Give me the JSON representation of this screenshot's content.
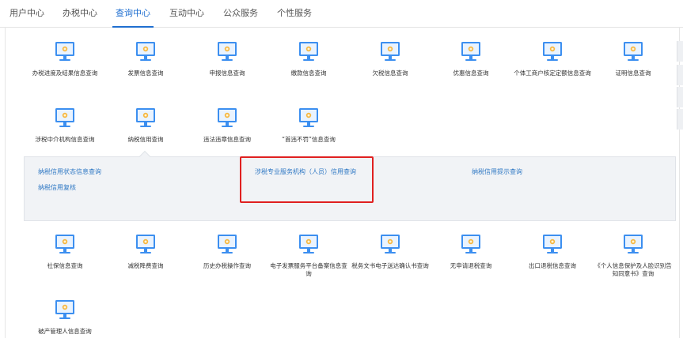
{
  "nav": {
    "tabs": [
      {
        "label": "用户中心"
      },
      {
        "label": "办税中心"
      },
      {
        "label": "查询中心"
      },
      {
        "label": "互动中心"
      },
      {
        "label": "公众服务"
      },
      {
        "label": "个性服务"
      }
    ]
  },
  "icon_name": "monitor-icon",
  "colors": {
    "accent": "#1f6fd0",
    "icon": "#3c8ff0",
    "highlight": "#e02020",
    "link": "#2f78c4"
  },
  "row1": [
    {
      "label": "办税进度及结果信息查询"
    },
    {
      "label": "发票信息查询"
    },
    {
      "label": "申报信息查询"
    },
    {
      "label": "缴款信息查询"
    },
    {
      "label": "欠税信息查询"
    },
    {
      "label": "优惠信息查询"
    },
    {
      "label": "个体工商户核定定额信息查询"
    },
    {
      "label": "证明信息查询"
    }
  ],
  "row2": [
    {
      "label": "涉税中介机构信息查询"
    },
    {
      "label": "纳税信用查询"
    },
    {
      "label": "违法违章信息查询"
    },
    {
      "label": "“首违不罚”信息查询"
    }
  ],
  "submenu": {
    "links": [
      {
        "label": "纳税信用状态信息查询"
      },
      {
        "label": "纳税信用复核"
      },
      {
        "label": "涉税专业服务机构（人员）信用查询"
      },
      {
        "label": "纳税信用提示查询"
      }
    ]
  },
  "row3": [
    {
      "label": "社保信息查询"
    },
    {
      "label": "减税降费查询"
    },
    {
      "label": "历史办税操作查询"
    },
    {
      "label": "电子发票服务平台备案信息查询"
    },
    {
      "label": "税务文书电子送达确认书查询"
    },
    {
      "label": "无申请退税查询"
    },
    {
      "label": "出口退税信息查询"
    },
    {
      "label": "《个人信息保护及人脸识别告知同意书》查询"
    }
  ],
  "row4": [
    {
      "label": "破产管理人信息查询"
    }
  ]
}
